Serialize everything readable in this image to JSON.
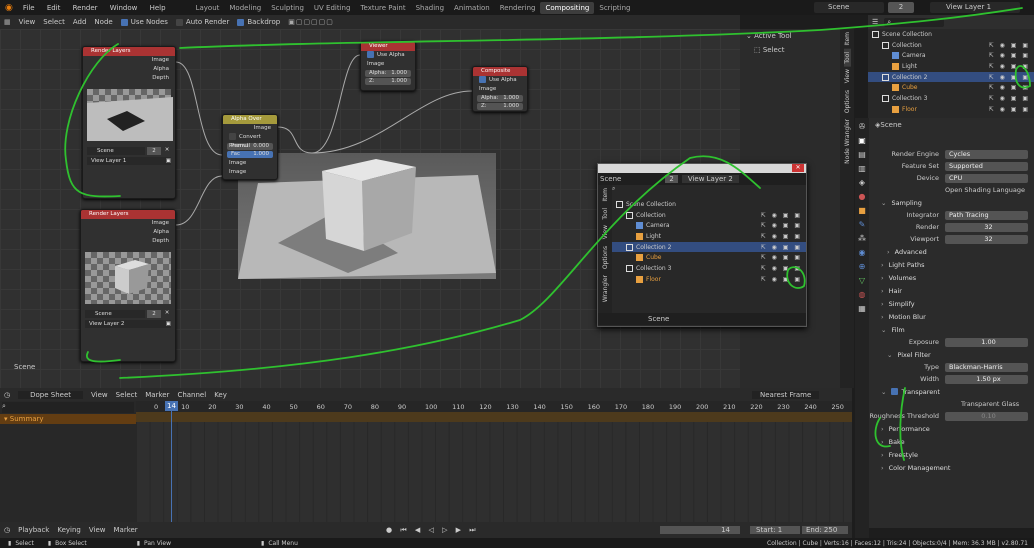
{
  "topbar": {
    "menus": [
      "File",
      "Edit",
      "Render",
      "Window",
      "Help"
    ],
    "workspaces": [
      "Layout",
      "Modeling",
      "Sculpting",
      "UV Editing",
      "Texture Paint",
      "Shading",
      "Animation",
      "Rendering",
      "Compositing",
      "Scripting"
    ],
    "active_workspace": "Compositing",
    "scene": "Scene",
    "scene_count": "2",
    "view_layer": "View Layer 1"
  },
  "node_header": {
    "menus": [
      "View",
      "Select",
      "Add",
      "Node"
    ],
    "use_nodes": "Use Nodes",
    "auto_render": "Auto Render",
    "backdrop": "Backdrop"
  },
  "nodes": {
    "rl1": {
      "title": "Render Layers",
      "outputs": [
        "Image",
        "Alpha",
        "Depth"
      ],
      "scene": "Scene",
      "count": "2",
      "layer": "View Layer 1"
    },
    "rl2": {
      "title": "Render Layers",
      "outputs": [
        "Image",
        "Alpha",
        "Depth"
      ],
      "scene": "Scene",
      "count": "2",
      "layer": "View Layer 2"
    },
    "alphaover": {
      "title": "Alpha Over",
      "out": "Image",
      "convert": "Convert Premul",
      "premul": "Premul",
      "premul_val": "0.000",
      "fac": "Fac",
      "fac_val": "1.000",
      "in1": "Image",
      "in2": "Image"
    },
    "viewer": {
      "title": "Viewer",
      "use_alpha": "Use Alpha",
      "image": "Image",
      "alpha": "Alpha:",
      "alpha_val": "1.000",
      "z": "Z:",
      "z_val": "1.000"
    },
    "composite": {
      "title": "Composite",
      "use_alpha": "Use Alpha",
      "image": "Image",
      "alpha": "Alpha:",
      "alpha_val": "1.000",
      "z": "Z:",
      "z_val": "1.000"
    }
  },
  "editor_scene_label": "Scene",
  "n_panel": {
    "title": "Active Tool",
    "tool": "Select",
    "tabs": [
      "Item",
      "Tool",
      "View",
      "Options",
      "Node Wrangler"
    ]
  },
  "outliner": {
    "title": "Scene Collection",
    "rows": [
      {
        "name": "Collection",
        "indent": 1
      },
      {
        "name": "Camera",
        "indent": 2
      },
      {
        "name": "Light",
        "indent": 2
      },
      {
        "name": "Collection 2",
        "indent": 1,
        "sel": true
      },
      {
        "name": "Cube",
        "indent": 2
      },
      {
        "name": "Collection 3",
        "indent": 1
      },
      {
        "name": "Floor",
        "indent": 2
      }
    ]
  },
  "props": {
    "scene": "Scene",
    "render_engine_label": "Render Engine",
    "render_engine": "Cycles",
    "feature_set_label": "Feature Set",
    "feature_set": "Supported",
    "device_label": "Device",
    "device": "CPU",
    "osl": "Open Shading Language",
    "sampling": "Sampling",
    "integrator_label": "Integrator",
    "integrator": "Path Tracing",
    "render_label": "Render",
    "render_val": "32",
    "viewport_label": "Viewport",
    "viewport_val": "32",
    "advanced": "Advanced",
    "light_paths": "Light Paths",
    "volumes": "Volumes",
    "hair": "Hair",
    "simplify": "Simplify",
    "motion_blur": "Motion Blur",
    "film": "Film",
    "exposure_label": "Exposure",
    "exposure": "1.00",
    "pixel_filter": "Pixel Filter",
    "type_label": "Type",
    "type": "Blackman-Harris",
    "width_label": "Width",
    "width": "1.50 px",
    "transparent": "Transparent",
    "transparent_glass": "Transparent Glass",
    "roughness_label": "Roughness Threshold",
    "roughness": "0.10",
    "performance": "Performance",
    "bake": "Bake",
    "freestyle": "Freestyle",
    "color_management": "Color Management"
  },
  "floatwin": {
    "scene": "Scene",
    "count": "2",
    "view_layer": "View Layer 2",
    "tabs": [
      "Item",
      "Tool",
      "View",
      "Options",
      "Wrangler"
    ],
    "footer": "Scene"
  },
  "dopesheet": {
    "mode": "Dope Sheet",
    "menus": [
      "View",
      "Select",
      "Marker",
      "Channel",
      "Key"
    ],
    "snap": "Nearest Frame",
    "summary": "Summary",
    "current": "14",
    "ticks": [
      "0",
      "10",
      "20",
      "30",
      "40",
      "50",
      "60",
      "70",
      "80",
      "90",
      "100",
      "110",
      "120",
      "130",
      "140",
      "150",
      "160",
      "170",
      "180",
      "190",
      "200",
      "210",
      "220",
      "230",
      "240",
      "250"
    ]
  },
  "timeline": {
    "menus": [
      "Playback",
      "Keying",
      "View",
      "Marker"
    ],
    "frame": "14",
    "start_label": "Start:",
    "start": "1",
    "end_label": "End:",
    "end": "250"
  },
  "status": {
    "select": "Select",
    "box": "Box Select",
    "pan": "Pan View",
    "menu": "Call Menu",
    "info": "Collection | Cube | Verts:16 | Faces:12 | Tris:24 | Objects:0/4 | Mem: 36.3 MB | v2.80.71"
  }
}
